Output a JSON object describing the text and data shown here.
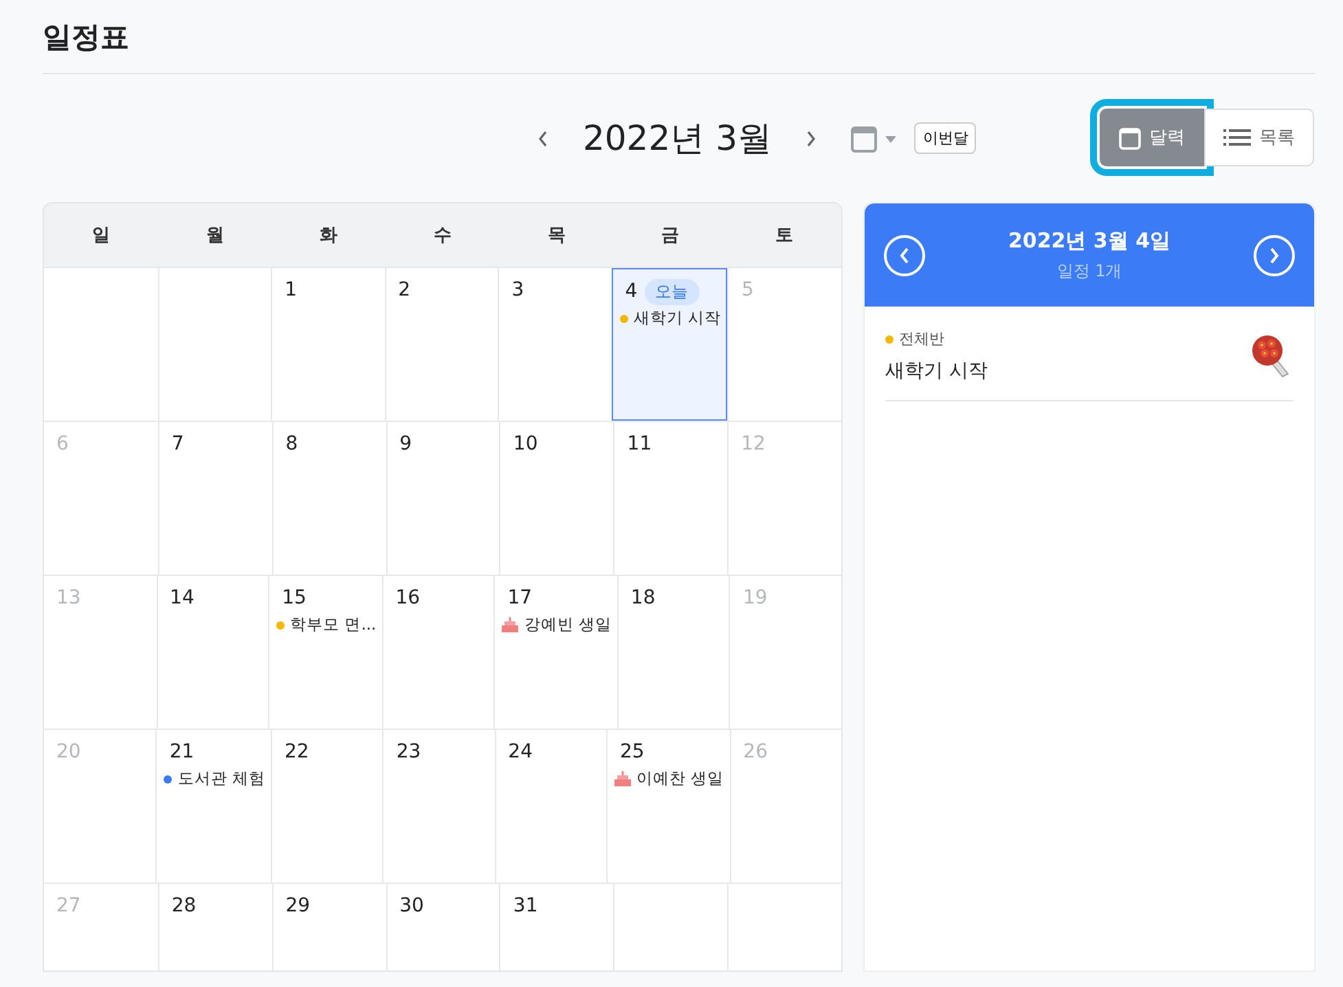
{
  "page_title": "일정표",
  "toolbar": {
    "month_label": "2022년 3월",
    "this_month_button": "이번달",
    "views": [
      {
        "label": "달력",
        "kind": "calendar",
        "selected": true
      },
      {
        "label": "목록",
        "kind": "list",
        "selected": false
      }
    ]
  },
  "weekdays": [
    "일",
    "월",
    "화",
    "수",
    "목",
    "금",
    "토"
  ],
  "weeks": [
    [
      {
        "kind": "blank"
      },
      {
        "kind": "blank"
      },
      {
        "kind": "day",
        "day": "1",
        "muted": false,
        "today": false
      },
      {
        "kind": "day",
        "day": "2",
        "muted": false,
        "today": false
      },
      {
        "kind": "day",
        "day": "3",
        "muted": false,
        "today": false
      },
      {
        "kind": "day",
        "day": "4",
        "muted": false,
        "today": true,
        "today_badge": "오늘",
        "events": [
          {
            "kind": "dot",
            "label": "새학기 시작",
            "color": "#f5b800"
          }
        ]
      },
      {
        "kind": "day",
        "day": "5",
        "muted": true,
        "today": false
      }
    ],
    [
      {
        "kind": "day",
        "day": "6",
        "muted": true,
        "today": false
      },
      {
        "kind": "day",
        "day": "7",
        "muted": false,
        "today": false
      },
      {
        "kind": "day",
        "day": "8",
        "muted": false,
        "today": false
      },
      {
        "kind": "day",
        "day": "9",
        "muted": false,
        "today": false
      },
      {
        "kind": "day",
        "day": "10",
        "muted": false,
        "today": false
      },
      {
        "kind": "day",
        "day": "11",
        "muted": false,
        "today": false
      },
      {
        "kind": "day",
        "day": "12",
        "muted": true,
        "today": false
      }
    ],
    [
      {
        "kind": "day",
        "day": "13",
        "muted": true,
        "today": false
      },
      {
        "kind": "day",
        "day": "14",
        "muted": false,
        "today": false
      },
      {
        "kind": "day",
        "day": "15",
        "muted": false,
        "today": false,
        "events": [
          {
            "kind": "dot",
            "label": "학부모 면...",
            "color": "#f5b800"
          }
        ]
      },
      {
        "kind": "day",
        "day": "16",
        "muted": false,
        "today": false
      },
      {
        "kind": "day",
        "day": "17",
        "muted": false,
        "today": false,
        "events": [
          {
            "kind": "birthday",
            "label": "강예빈 생일"
          }
        ]
      },
      {
        "kind": "day",
        "day": "18",
        "muted": false,
        "today": false
      },
      {
        "kind": "day",
        "day": "19",
        "muted": true,
        "today": false
      }
    ],
    [
      {
        "kind": "day",
        "day": "20",
        "muted": true,
        "today": false
      },
      {
        "kind": "day",
        "day": "21",
        "muted": false,
        "today": false,
        "events": [
          {
            "kind": "dot",
            "label": "도서관 체험",
            "color": "#3b7cf6"
          }
        ]
      },
      {
        "kind": "day",
        "day": "22",
        "muted": false,
        "today": false
      },
      {
        "kind": "day",
        "day": "23",
        "muted": false,
        "today": false
      },
      {
        "kind": "day",
        "day": "24",
        "muted": false,
        "today": false
      },
      {
        "kind": "day",
        "day": "25",
        "muted": false,
        "today": false,
        "events": [
          {
            "kind": "birthday",
            "label": "이예찬 생일"
          }
        ]
      },
      {
        "kind": "day",
        "day": "26",
        "muted": true,
        "today": false
      }
    ],
    [
      {
        "kind": "day",
        "day": "27",
        "muted": true,
        "today": false
      },
      {
        "kind": "day",
        "day": "28",
        "muted": false,
        "today": false
      },
      {
        "kind": "day",
        "day": "29",
        "muted": false,
        "today": false
      },
      {
        "kind": "day",
        "day": "30",
        "muted": false,
        "today": false
      },
      {
        "kind": "day",
        "day": "31",
        "muted": false,
        "today": false
      },
      {
        "kind": "blank"
      },
      {
        "kind": "blank"
      }
    ]
  ],
  "day_panel": {
    "date": "2022년 3월 4일",
    "count": "일정 1개",
    "items": [
      {
        "group": "전체반",
        "color": "#f5b800",
        "title": "새학기 시작"
      }
    ]
  }
}
